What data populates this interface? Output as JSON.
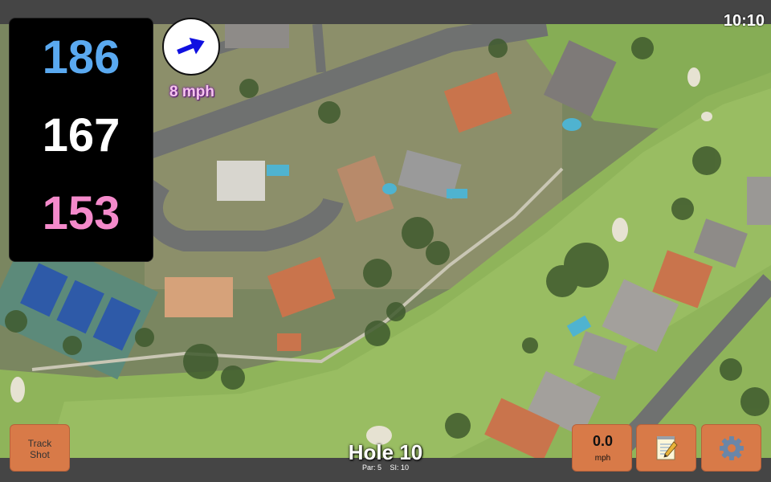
{
  "status": {
    "time": "10:10"
  },
  "distances": {
    "back": "186",
    "middle": "167",
    "front": "153"
  },
  "wind": {
    "label": "8 mph",
    "direction_icon": "arrow-right-up-icon",
    "color": "#1010e0"
  },
  "hole": {
    "title": "Hole 10",
    "par_label": "Par: 5",
    "si_label": "SI: 10"
  },
  "buttons": {
    "track_shot_line1": "Track",
    "track_shot_line2": "Shot",
    "speed_value": "0.0",
    "speed_unit": "mph",
    "notes_icon": "notepad-icon",
    "settings_icon": "gear-icon"
  },
  "colors": {
    "back": "#5aa9f0",
    "middle": "#ffffff",
    "front": "#f48acb",
    "button": "#d87a48",
    "fairway": "#8fb45a"
  }
}
